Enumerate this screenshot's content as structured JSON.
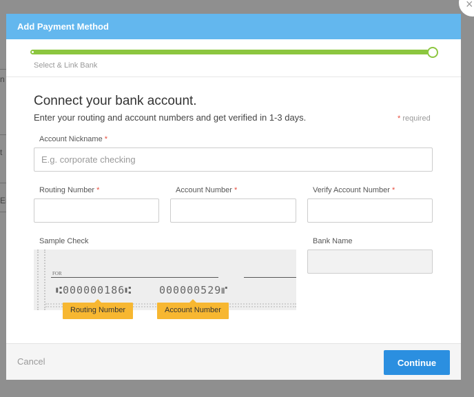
{
  "background": {
    "fragments": [
      "n",
      "t",
      "Er"
    ]
  },
  "modal": {
    "title": "Add Payment Method",
    "close_symbol": "×",
    "progress": {
      "step_label": "Select & Link Bank",
      "fraction": 1.0
    },
    "heading": "Connect your bank account.",
    "subheading": "Enter your routing and account numbers and get verified in 1-3 days.",
    "required_note": {
      "star": "*",
      "text": "required"
    },
    "fields": {
      "nickname": {
        "label": "Account Nickname",
        "star": "*",
        "placeholder": "E.g. corporate checking",
        "value": ""
      },
      "routing": {
        "label": "Routing Number",
        "star": "*",
        "value": ""
      },
      "account": {
        "label": "Account Number",
        "star": "*",
        "value": ""
      },
      "verify": {
        "label": "Verify Account Number",
        "star": "*",
        "value": ""
      },
      "bank_name": {
        "label": "Bank Name",
        "value": ""
      }
    },
    "sample_check": {
      "label": "Sample Check",
      "for_text": "FOR",
      "routing_micr": "⑆000000186⑆",
      "account_micr": "000000529⑈",
      "routing_tag": "Routing Number",
      "account_tag": "Account Number"
    },
    "footer": {
      "cancel_label": "Cancel",
      "continue_label": "Continue"
    }
  },
  "colors": {
    "header": "#63b7ee",
    "progress": "#8cc63f",
    "primary_button": "#2b8fe0",
    "tag": "#f7b731",
    "required": "#e74c3c"
  },
  "icons": {
    "close": "close-icon"
  }
}
